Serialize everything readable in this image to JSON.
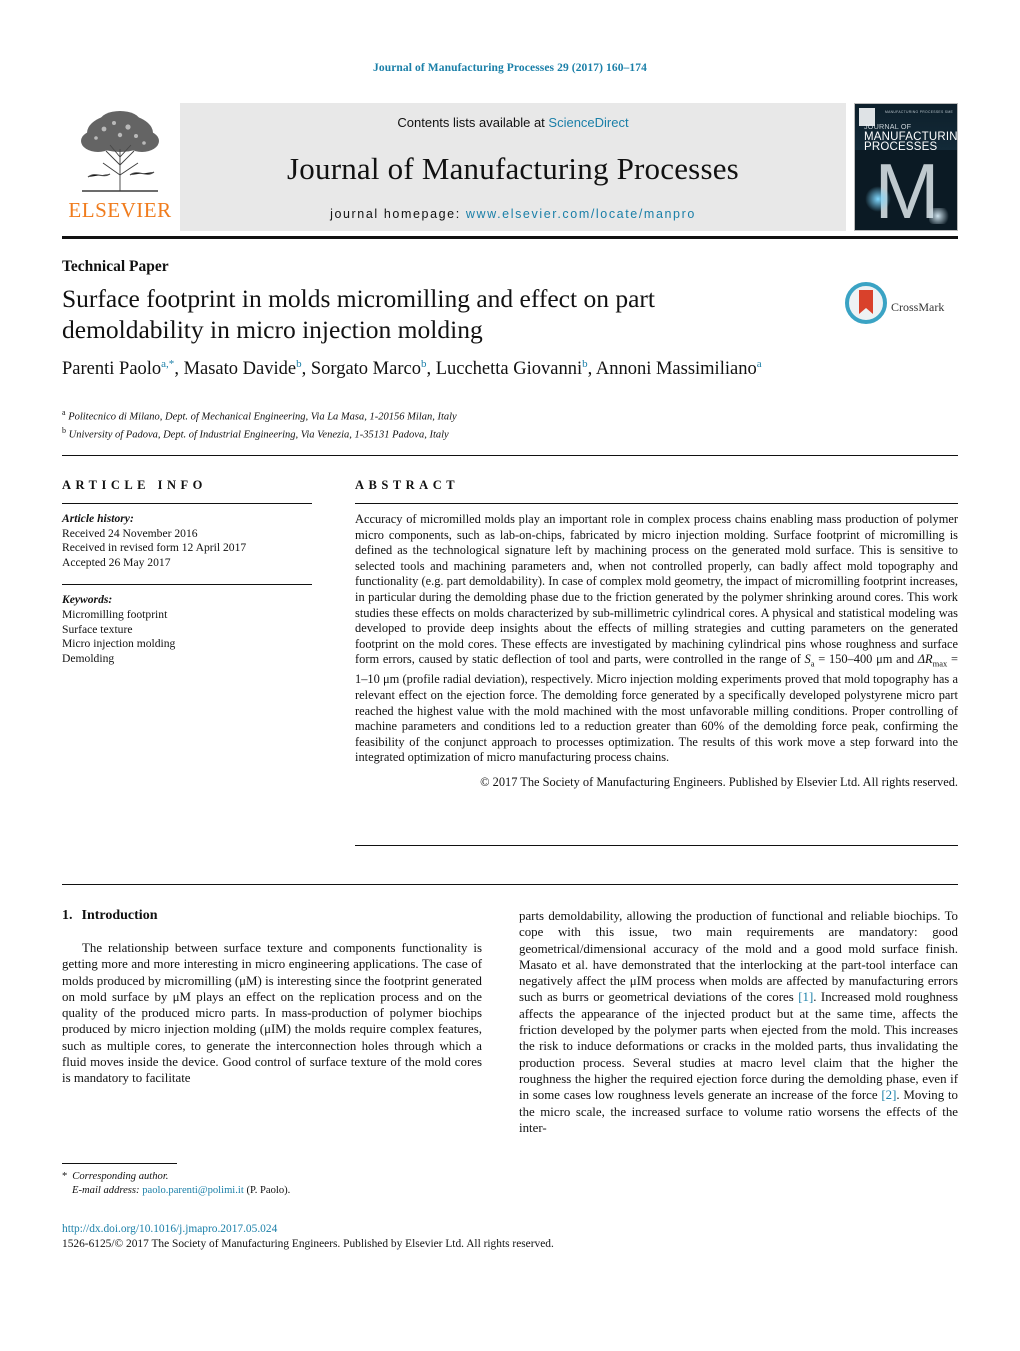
{
  "running_head": "Journal of Manufacturing Processes 29 (2017) 160–174",
  "masthead": {
    "publisher": "ELSEVIER",
    "contents_prefix": "Contents lists available at ",
    "contents_link": "ScienceDirect",
    "journal_name": "Journal of Manufacturing Processes",
    "homepage_prefix": "journal homepage: ",
    "homepage_url": "www.elsevier.com/locate/manpro",
    "cover": {
      "tiny_line": "MANUFACTURING PROCESSES SME",
      "title_small": "JOURNAL OF",
      "title_large": "MANUFACTURING",
      "title_large2": "PROCESSES",
      "big_letter": "M"
    }
  },
  "article": {
    "type": "Technical Paper",
    "title": "Surface footprint in molds micromilling and effect on part demoldability in micro injection molding",
    "crossmark_label": "CrossMark",
    "authors": [
      {
        "name": "Parenti Paolo",
        "marks": "a,*"
      },
      {
        "name": "Masato Davide",
        "marks": "b"
      },
      {
        "name": "Sorgato Marco",
        "marks": "b"
      },
      {
        "name": "Lucchetta Giovanni",
        "marks": "b"
      },
      {
        "name": "Annoni Massimiliano",
        "marks": "a"
      }
    ],
    "affiliations": [
      {
        "mark": "a",
        "text": "Politecnico di Milano, Dept. of Mechanical Engineering, Via La Masa, 1-20156 Milan, Italy"
      },
      {
        "mark": "b",
        "text": "University of Padova, Dept. of Industrial Engineering, Via Venezia, 1-35131 Padova, Italy"
      }
    ]
  },
  "info": {
    "heading": "ARTICLE INFO",
    "history_label": "Article history:",
    "history": [
      "Received 24 November 2016",
      "Received in revised form 12 April 2017",
      "Accepted 26 May 2017"
    ],
    "keywords_label": "Keywords:",
    "keywords": [
      "Micromilling footprint",
      "Surface texture",
      "Micro injection molding",
      "Demolding"
    ]
  },
  "abstract": {
    "heading": "ABSTRACT",
    "part1": "Accuracy of micromilled molds play an important role in complex process chains enabling mass production of polymer micro components, such as lab-on-chips, fabricated by micro injection molding. Surface footprint of micromilling is defined as the technological signature left by machining process on the generated mold surface. This is sensitive to selected tools and machining parameters and, when not controlled properly, can badly affect mold topography and functionality (e.g. part demoldability). In case of complex mold geometry, the impact of micromilling footprint increases, in particular during the demolding phase due to the friction generated by the polymer shrinking around cores. This work studies these effects on molds characterized by sub-millimetric cylindrical cores. A physical and statistical modeling was developed to provide deep insights about the effects of milling strategies and cutting parameters on the generated footprint on the mold cores. These effects are investigated by machining cylindrical pins whose roughness and surface form errors, caused by static deflection of tool and parts, were controlled in the range of ",
    "sym_sa": "S",
    "sym_sa_sub": "a",
    "range_sa": " = 150–400 μm and ",
    "sym_dr": "ΔR",
    "sym_dr_sub": "max",
    "range_dr": " = 1–10 μm (profile radial deviation), respectively. ",
    "part2": "Micro injection molding experiments proved that mold topography has a relevant effect on the ejection force. The demolding force generated by a specifically developed polystyrene micro part reached the highest value with the mold machined with the most unfavorable milling conditions. Proper controlling of machine parameters and conditions led to a reduction greater than 60% of the demolding force peak, confirming the feasibility of the conjunct approach to processes optimization. The results of this work move a step forward into the integrated optimization of micro manufacturing process chains.",
    "copyright": "© 2017 The Society of Manufacturing Engineers. Published by Elsevier Ltd. All rights reserved."
  },
  "body": {
    "section_number": "1.",
    "section_title": "Introduction",
    "left_para": "The relationship between surface texture and components functionality is getting more and more interesting in micro engineering applications. The case of molds produced by micromilling (μM) is interesting since the footprint generated on mold surface by μM plays an effect on the replication process and on the quality of the produced micro parts. In mass-production of polymer biochips produced by micro injection molding (μIM) the molds require complex features, such as multiple cores, to generate the interconnection holes through which a fluid moves inside the device. Good control of surface texture of the mold cores is mandatory to facilitate",
    "right_para_1": "parts demoldability, allowing the production of functional and reliable biochips. To cope with this issue, two main requirements are mandatory: good geometrical/dimensional accuracy of the mold and a good mold surface finish. Masato et al. have demonstrated that the interlocking at the part-tool interface can negatively affect the μIM process when molds are affected by manufacturing errors such as burrs or geometrical deviations of the cores ",
    "cite_1": "[1]",
    "right_para_2": ". Increased mold roughness affects the appearance of the injected product but at the same time, affects the friction developed by the polymer parts when ejected from the mold. This increases the risk to induce deformations or cracks in the molded parts, thus invalidating the production process. Several studies at macro level claim that the higher the roughness the higher the required ejection force during the demolding phase, even if in some cases low roughness levels generate an increase of the force ",
    "cite_2": "[2]",
    "right_para_3": ". Moving to the micro scale, the increased surface to volume ratio worsens the effects of the inter-"
  },
  "footnote": {
    "star": "*",
    "corresponding": "Corresponding author.",
    "email_label": "E-mail address:",
    "email": "paolo.parenti@polimi.it",
    "email_suffix": "(P. Paolo)."
  },
  "footer": {
    "doi": "http://dx.doi.org/10.1016/j.jmapro.2017.05.024",
    "issn_line": "1526-6125/© 2017 The Society of Manufacturing Engineers. Published by Elsevier Ltd. All rights reserved."
  },
  "colors": {
    "link_blue": "#1a7fa8",
    "elsevier_orange": "#f07c1d",
    "crossmark_blue": "#3aa3c4",
    "crossmark_red": "#d9412b"
  }
}
